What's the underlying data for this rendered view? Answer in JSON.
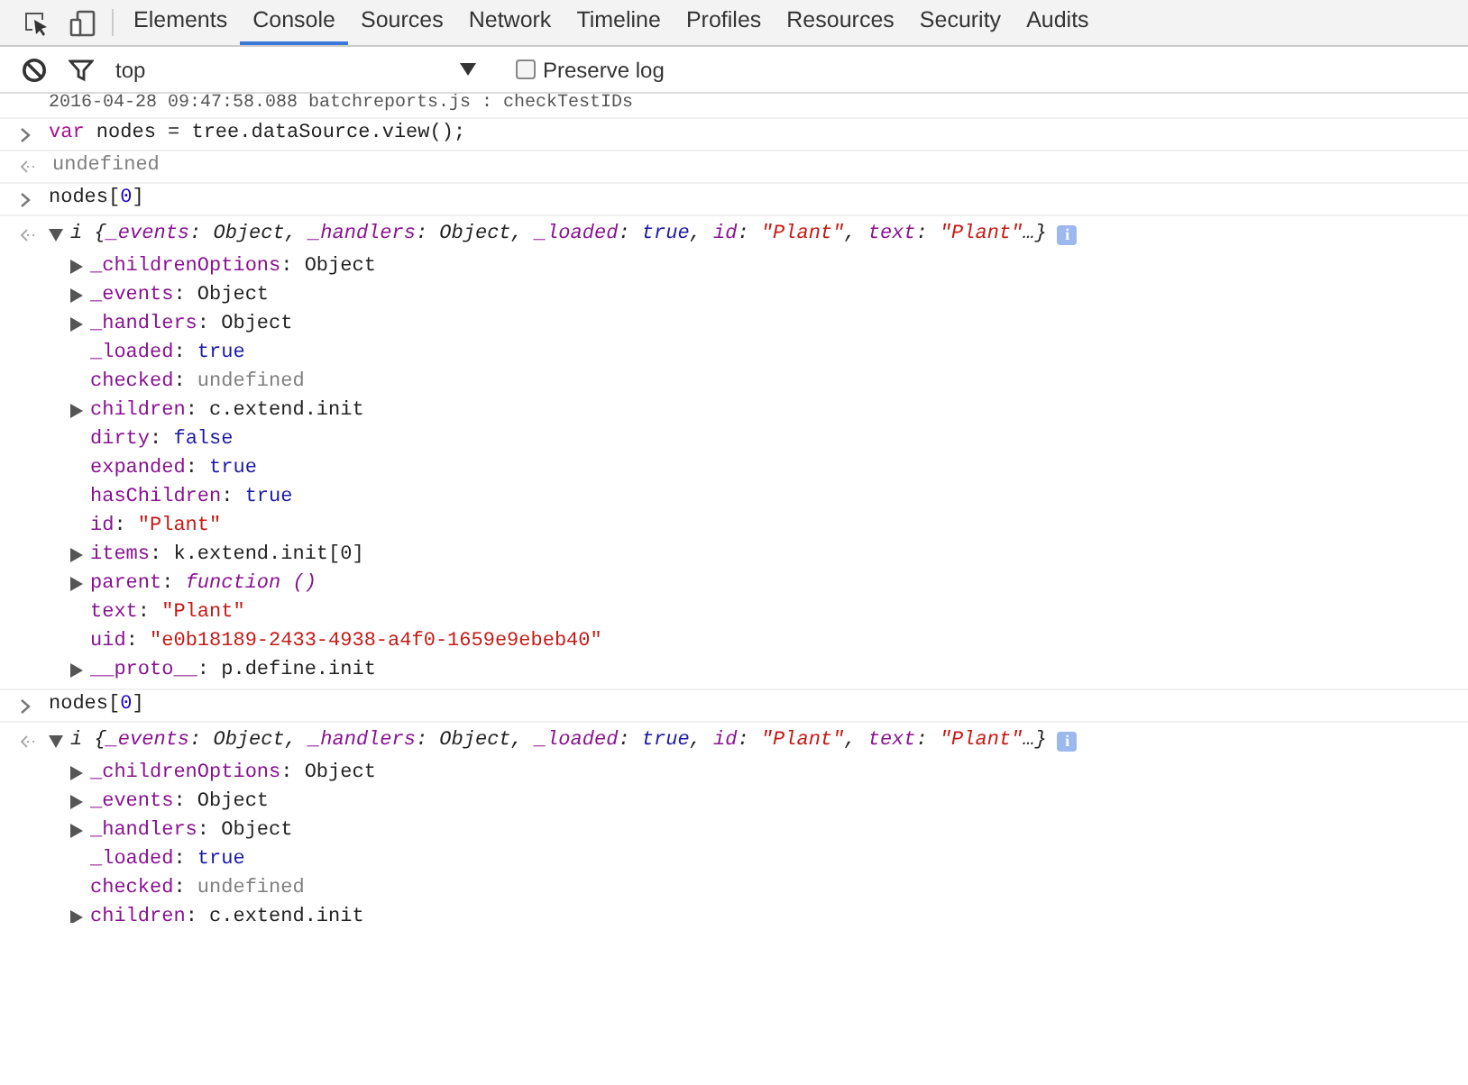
{
  "tabs": [
    {
      "label": "Elements",
      "selected": false
    },
    {
      "label": "Console",
      "selected": true
    },
    {
      "label": "Sources",
      "selected": false
    },
    {
      "label": "Network",
      "selected": false
    },
    {
      "label": "Timeline",
      "selected": false
    },
    {
      "label": "Profiles",
      "selected": false
    },
    {
      "label": "Resources",
      "selected": false
    },
    {
      "label": "Security",
      "selected": false
    },
    {
      "label": "Audits",
      "selected": false
    }
  ],
  "toolbar": {
    "context": "top",
    "preserve_log": {
      "label": "Preserve log",
      "checked": false
    }
  },
  "console": [
    {
      "kind": "log",
      "text": "2016-04-28 09:47:58.088 batchreports.js : checkTestIDs"
    },
    {
      "kind": "input",
      "tokens": [
        {
          "t": "var",
          "kind": "keyword"
        },
        {
          "t": " nodes = tree.dataSource.view();",
          "kind": "plain"
        }
      ]
    },
    {
      "kind": "result",
      "tokens": [
        {
          "t": "undefined",
          "kind": "undefined"
        }
      ]
    },
    {
      "kind": "input",
      "tokens": [
        {
          "t": "nodes[",
          "kind": "plain"
        },
        {
          "t": "0",
          "kind": "number"
        },
        {
          "t": "]",
          "kind": "plain"
        }
      ]
    },
    {
      "kind": "object",
      "expanded": true,
      "info_badge": "i",
      "summary": [
        {
          "t": "i {",
          "kind": "plain"
        },
        {
          "t": "_events",
          "kind": "key"
        },
        {
          "t": ": Object, ",
          "kind": "plain"
        },
        {
          "t": "_handlers",
          "kind": "key"
        },
        {
          "t": ": Object, ",
          "kind": "plain"
        },
        {
          "t": "_loaded",
          "kind": "key"
        },
        {
          "t": ": ",
          "kind": "plain"
        },
        {
          "t": "true",
          "kind": "boolean"
        },
        {
          "t": ", ",
          "kind": "plain"
        },
        {
          "t": "id",
          "kind": "key"
        },
        {
          "t": ": ",
          "kind": "plain"
        },
        {
          "t": "\"Plant\"",
          "kind": "string"
        },
        {
          "t": ", ",
          "kind": "plain"
        },
        {
          "t": "text",
          "kind": "key"
        },
        {
          "t": ": ",
          "kind": "plain"
        },
        {
          "t": "\"Plant\"",
          "kind": "string"
        },
        {
          "t": "…}",
          "kind": "plain"
        }
      ],
      "properties": [
        {
          "expandable": true,
          "tokens": [
            {
              "t": "_childrenOptions",
              "kind": "key"
            },
            {
              "t": ": ",
              "kind": "plain"
            },
            {
              "t": "Object",
              "kind": "object"
            }
          ]
        },
        {
          "expandable": true,
          "tokens": [
            {
              "t": "_events",
              "kind": "key"
            },
            {
              "t": ": ",
              "kind": "plain"
            },
            {
              "t": "Object",
              "kind": "object"
            }
          ]
        },
        {
          "expandable": true,
          "tokens": [
            {
              "t": "_handlers",
              "kind": "key"
            },
            {
              "t": ": ",
              "kind": "plain"
            },
            {
              "t": "Object",
              "kind": "object"
            }
          ]
        },
        {
          "expandable": false,
          "tokens": [
            {
              "t": "_loaded",
              "kind": "key"
            },
            {
              "t": ": ",
              "kind": "plain"
            },
            {
              "t": "true",
              "kind": "boolean"
            }
          ]
        },
        {
          "expandable": false,
          "tokens": [
            {
              "t": "checked",
              "kind": "key"
            },
            {
              "t": ": ",
              "kind": "plain"
            },
            {
              "t": "undefined",
              "kind": "undefined"
            }
          ]
        },
        {
          "expandable": true,
          "tokens": [
            {
              "t": "children",
              "kind": "key"
            },
            {
              "t": ": ",
              "kind": "plain"
            },
            {
              "t": "c.extend.init",
              "kind": "object"
            }
          ]
        },
        {
          "expandable": false,
          "tokens": [
            {
              "t": "dirty",
              "kind": "key"
            },
            {
              "t": ": ",
              "kind": "plain"
            },
            {
              "t": "false",
              "kind": "boolean"
            }
          ]
        },
        {
          "expandable": false,
          "tokens": [
            {
              "t": "expanded",
              "kind": "key"
            },
            {
              "t": ": ",
              "kind": "plain"
            },
            {
              "t": "true",
              "kind": "boolean"
            }
          ]
        },
        {
          "expandable": false,
          "tokens": [
            {
              "t": "hasChildren",
              "kind": "key"
            },
            {
              "t": ": ",
              "kind": "plain"
            },
            {
              "t": "true",
              "kind": "boolean"
            }
          ]
        },
        {
          "expandable": false,
          "tokens": [
            {
              "t": "id",
              "kind": "key"
            },
            {
              "t": ": ",
              "kind": "plain"
            },
            {
              "t": "\"Plant\"",
              "kind": "string"
            }
          ]
        },
        {
          "expandable": true,
          "tokens": [
            {
              "t": "items",
              "kind": "key"
            },
            {
              "t": ": ",
              "kind": "plain"
            },
            {
              "t": "k.extend.init[0]",
              "kind": "object"
            }
          ]
        },
        {
          "expandable": true,
          "tokens": [
            {
              "t": "parent",
              "kind": "key"
            },
            {
              "t": ": ",
              "kind": "plain"
            },
            {
              "t": "function ()",
              "kind": "function"
            }
          ]
        },
        {
          "expandable": false,
          "tokens": [
            {
              "t": "text",
              "kind": "key"
            },
            {
              "t": ": ",
              "kind": "plain"
            },
            {
              "t": "\"Plant\"",
              "kind": "string"
            }
          ]
        },
        {
          "expandable": false,
          "tokens": [
            {
              "t": "uid",
              "kind": "key"
            },
            {
              "t": ": ",
              "kind": "plain"
            },
            {
              "t": "\"e0b18189-2433-4938-a4f0-1659e9ebeb40\"",
              "kind": "string"
            }
          ]
        },
        {
          "expandable": true,
          "tokens": [
            {
              "t": "__proto__",
              "kind": "key"
            },
            {
              "t": ": ",
              "kind": "plain"
            },
            {
              "t": "p.define.init",
              "kind": "object"
            }
          ]
        }
      ]
    },
    {
      "kind": "input",
      "tokens": [
        {
          "t": "nodes[",
          "kind": "plain"
        },
        {
          "t": "0",
          "kind": "number"
        },
        {
          "t": "]",
          "kind": "plain"
        }
      ]
    },
    {
      "kind": "object",
      "expanded": true,
      "info_badge": "i",
      "summary": [
        {
          "t": "i {",
          "kind": "plain"
        },
        {
          "t": "_events",
          "kind": "key"
        },
        {
          "t": ": Object, ",
          "kind": "plain"
        },
        {
          "t": "_handlers",
          "kind": "key"
        },
        {
          "t": ": Object, ",
          "kind": "plain"
        },
        {
          "t": "_loaded",
          "kind": "key"
        },
        {
          "t": ": ",
          "kind": "plain"
        },
        {
          "t": "true",
          "kind": "boolean"
        },
        {
          "t": ", ",
          "kind": "plain"
        },
        {
          "t": "id",
          "kind": "key"
        },
        {
          "t": ": ",
          "kind": "plain"
        },
        {
          "t": "\"Plant\"",
          "kind": "string"
        },
        {
          "t": ", ",
          "kind": "plain"
        },
        {
          "t": "text",
          "kind": "key"
        },
        {
          "t": ": ",
          "kind": "plain"
        },
        {
          "t": "\"Plant\"",
          "kind": "string"
        },
        {
          "t": "…}",
          "kind": "plain"
        }
      ],
      "properties": [
        {
          "expandable": true,
          "tokens": [
            {
              "t": "_childrenOptions",
              "kind": "key"
            },
            {
              "t": ": ",
              "kind": "plain"
            },
            {
              "t": "Object",
              "kind": "object"
            }
          ]
        },
        {
          "expandable": true,
          "tokens": [
            {
              "t": "_events",
              "kind": "key"
            },
            {
              "t": ": ",
              "kind": "plain"
            },
            {
              "t": "Object",
              "kind": "object"
            }
          ]
        },
        {
          "expandable": true,
          "tokens": [
            {
              "t": "_handlers",
              "kind": "key"
            },
            {
              "t": ": ",
              "kind": "plain"
            },
            {
              "t": "Object",
              "kind": "object"
            }
          ]
        },
        {
          "expandable": false,
          "tokens": [
            {
              "t": "_loaded",
              "kind": "key"
            },
            {
              "t": ": ",
              "kind": "plain"
            },
            {
              "t": "true",
              "kind": "boolean"
            }
          ]
        },
        {
          "expandable": false,
          "tokens": [
            {
              "t": "checked",
              "kind": "key"
            },
            {
              "t": ": ",
              "kind": "plain"
            },
            {
              "t": "undefined",
              "kind": "undefined"
            }
          ]
        },
        {
          "expandable": true,
          "tokens": [
            {
              "t": "children",
              "kind": "key"
            },
            {
              "t": ": ",
              "kind": "plain"
            },
            {
              "t": "c.extend.init",
              "kind": "object"
            }
          ]
        }
      ]
    }
  ]
}
